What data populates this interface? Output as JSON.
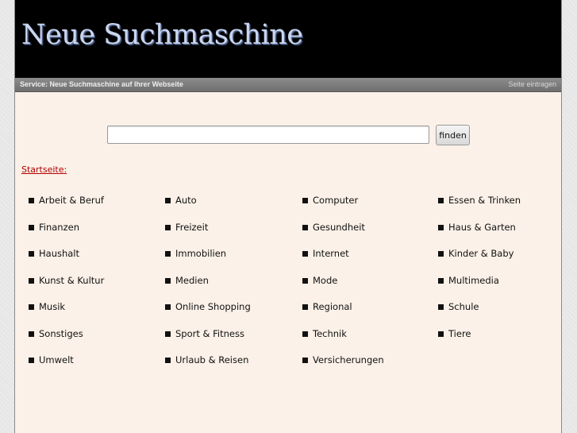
{
  "header": {
    "logo_text": "Neue Suchmaschine"
  },
  "servicebar": {
    "service_text": "Service: Neue Suchmaschine auf Ihrer Webseite",
    "submit_link": "Seite eintragen"
  },
  "search": {
    "input_value": "",
    "button_label": "finden"
  },
  "startseite_label": "Startseite:",
  "categories": [
    [
      "Arbeit & Beruf",
      "Auto",
      "Computer",
      "Essen & Trinken"
    ],
    [
      "Finanzen",
      "Freizeit",
      "Gesundheit",
      "Haus & Garten"
    ],
    [
      "Haushalt",
      "Immobilien",
      "Internet",
      "Kinder & Baby"
    ],
    [
      "Kunst & Kultur",
      "Medien",
      "Mode",
      "Multimedia"
    ],
    [
      "Musik",
      "Online Shopping",
      "Regional",
      "Schule"
    ],
    [
      "Sonstiges",
      "Sport & Fitness",
      "Technik",
      "Tiere"
    ],
    [
      "Umwelt",
      "Urlaub & Reisen",
      "Versicherungen"
    ]
  ],
  "colors": {
    "header_bg": "#000000",
    "content_bg": "#fbf1e8",
    "link_red": "#b00000",
    "logo": "#c9d6ee"
  }
}
